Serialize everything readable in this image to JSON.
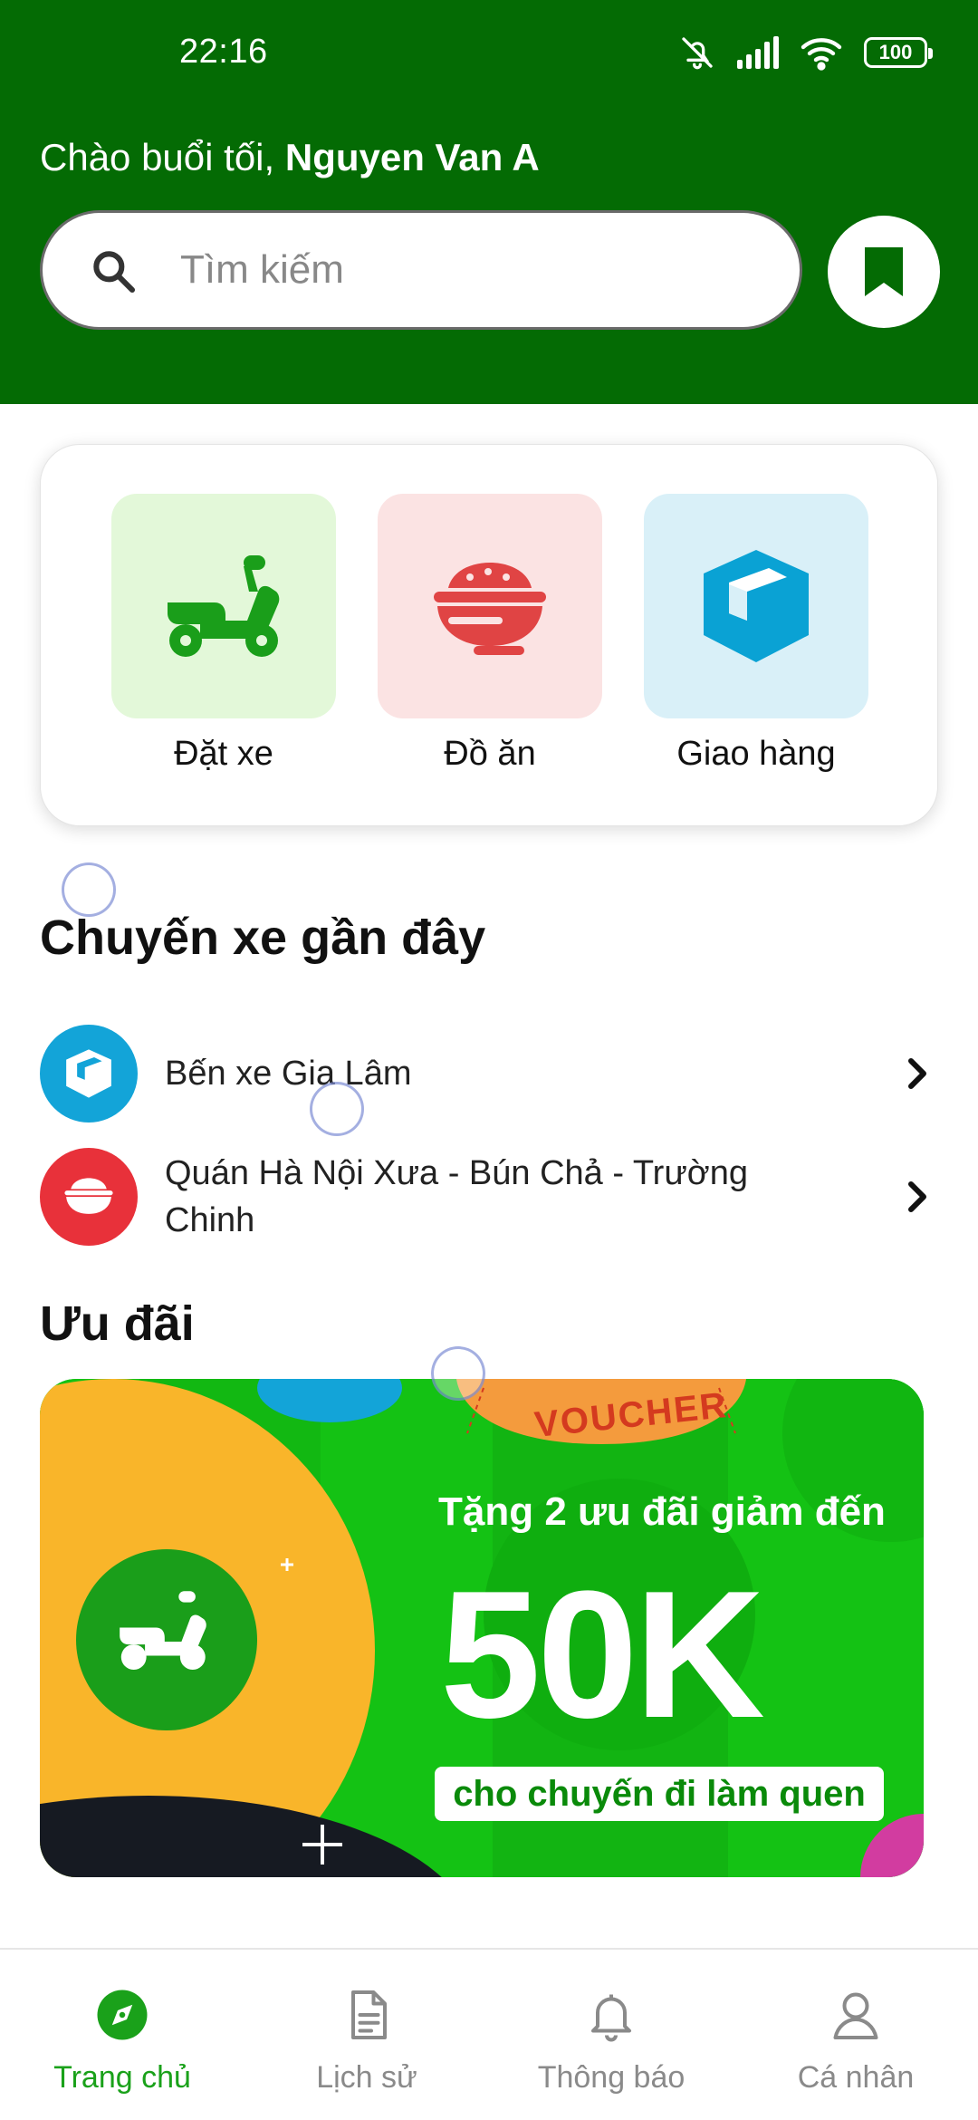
{
  "status_bar": {
    "time": "22:16",
    "battery": "100"
  },
  "header": {
    "greeting_prefix": "Chào buổi tối,",
    "user_name": "Nguyen Van A",
    "search_placeholder": "Tìm kiếm"
  },
  "services": [
    {
      "label": "Đặt xe",
      "icon": "scooter-icon",
      "bg": "#e3f8d9",
      "color": "#1a9e1a"
    },
    {
      "label": "Đồ ăn",
      "icon": "food-bowl-icon",
      "bg": "#fbe3e3",
      "color": "#e04444"
    },
    {
      "label": "Giao hàng",
      "icon": "package-icon",
      "bg": "#d9f0f8",
      "color": "#0aa2d4"
    }
  ],
  "recent_rides": {
    "title": "Chuyến xe gần đây",
    "items": [
      {
        "name": "Bến xe Gia Lâm",
        "icon": "package-icon",
        "color": "#13a4d8"
      },
      {
        "name": "Quán Hà Nội Xưa - Bún Chả - Trường Chinh",
        "icon": "food-bowl-icon",
        "color": "#e8313a"
      }
    ]
  },
  "promos": {
    "title": "Ưu đãi",
    "banner": {
      "voucher_label": "VOUCHER",
      "line1": "Tặng 2 ưu đãi giảm đến",
      "amount": "50K",
      "line2": "cho chuyến đi làm quen"
    }
  },
  "bottom_nav": [
    {
      "label": "Trang chủ",
      "icon": "compass-icon",
      "active": true
    },
    {
      "label": "Lịch sử",
      "icon": "document-icon",
      "active": false
    },
    {
      "label": "Thông báo",
      "icon": "bell-icon",
      "active": false
    },
    {
      "label": "Cá nhân",
      "icon": "person-icon",
      "active": false
    }
  ],
  "colors": {
    "brand_green": "#046b04",
    "accent_green": "#1aa11a",
    "banner_green": "#14c214",
    "banner_yellow": "#f9b52a"
  }
}
